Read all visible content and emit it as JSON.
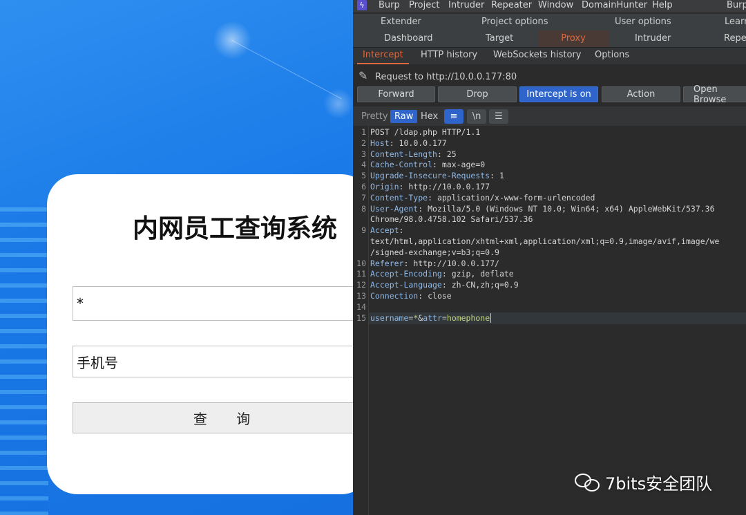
{
  "web": {
    "title": "内网员工查询系统",
    "username_value": "*",
    "phone_value": "手机号",
    "query_button": "查 询"
  },
  "burp": {
    "menu": [
      "Burp",
      "Project",
      "Intruder",
      "Repeater",
      "Window",
      "DomainHunter",
      "Help",
      "Burp"
    ],
    "top_tabs_row1": [
      "Extender",
      "Project options",
      "User options",
      "Learn"
    ],
    "top_tabs_row2": [
      "Dashboard",
      "Target",
      "Proxy",
      "Intruder",
      "Repea"
    ],
    "proxy_tabs": [
      "Intercept",
      "HTTP history",
      "WebSockets history",
      "Options"
    ],
    "request_to": "Request to http://10.0.0.177:80",
    "buttons": {
      "forward": "Forward",
      "drop": "Drop",
      "intercept": "Intercept is on",
      "action": "Action",
      "open_browser": "Open Browse"
    },
    "view": {
      "pretty": "Pretty",
      "raw": "Raw",
      "hex": "Hex",
      "newline": "\\n"
    },
    "lines": [
      {
        "n": "1",
        "k": "",
        "v": "POST /ldap.php HTTP/1.1"
      },
      {
        "n": "2",
        "k": "Host",
        "v": ": 10.0.0.177"
      },
      {
        "n": "3",
        "k": "Content-Length",
        "v": ": 25"
      },
      {
        "n": "4",
        "k": "Cache-Control",
        "v": ": max-age=0"
      },
      {
        "n": "5",
        "k": "Upgrade-Insecure-Requests",
        "v": ": 1"
      },
      {
        "n": "6",
        "k": "Origin",
        "v": ": http://10.0.0.177"
      },
      {
        "n": "7",
        "k": "Content-Type",
        "v": ": application/x-www-form-urlencoded"
      },
      {
        "n": "8",
        "k": "User-Agent",
        "v": ": Mozilla/5.0 (Windows NT 10.0; Win64; x64) AppleWebKit/537.36"
      },
      {
        "n": "",
        "k": "",
        "v": "Chrome/98.0.4758.102 Safari/537.36"
      },
      {
        "n": "9",
        "k": "Accept",
        "v": ":"
      },
      {
        "n": "",
        "k": "",
        "v": "text/html,application/xhtml+xml,application/xml;q=0.9,image/avif,image/we"
      },
      {
        "n": "",
        "k": "",
        "v": "/signed-exchange;v=b3;q=0.9"
      },
      {
        "n": "10",
        "k": "Referer",
        "v": ": http://10.0.0.177/"
      },
      {
        "n": "11",
        "k": "Accept-Encoding",
        "v": ": gzip, deflate"
      },
      {
        "n": "12",
        "k": "Accept-Language",
        "v": ": zh-CN,zh;q=0.9"
      },
      {
        "n": "13",
        "k": "Connection",
        "v": ": close"
      },
      {
        "n": "14",
        "k": "",
        "v": ""
      },
      {
        "n": "15",
        "k": "username",
        "v": "="
      }
    ],
    "body": {
      "star": "*",
      "amp": "&",
      "attr": "attr",
      "eq": "=",
      "val": "homephone"
    }
  },
  "watermark": "7bits安全团队"
}
